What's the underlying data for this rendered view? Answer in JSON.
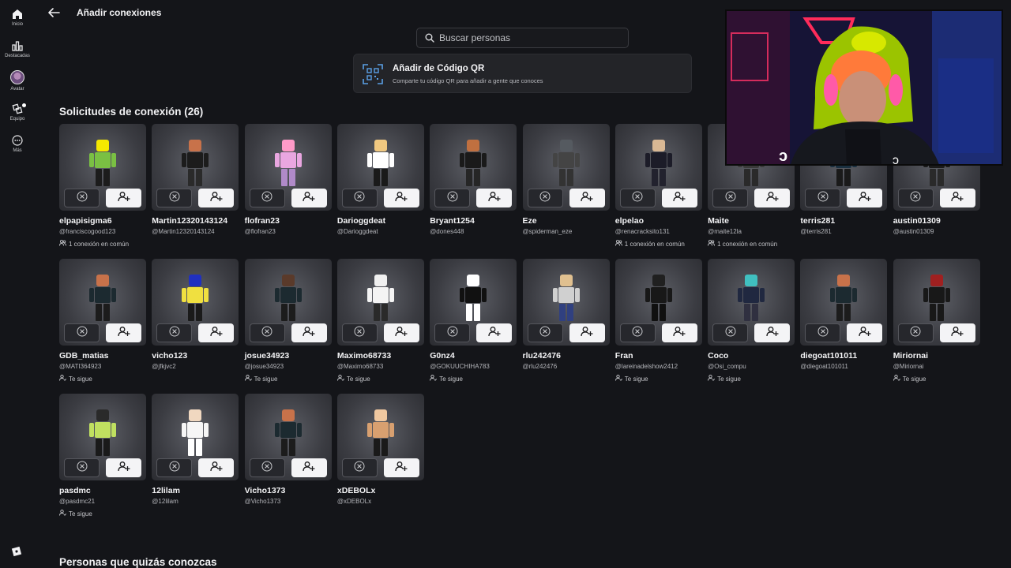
{
  "nav": {
    "items": [
      {
        "label": "Inicio",
        "icon": "home-icon"
      },
      {
        "label": "Destacadas",
        "icon": "charts-icon"
      },
      {
        "label": "Avatar",
        "icon": "avatar-icon"
      },
      {
        "label": "Equipo",
        "icon": "party-icon"
      },
      {
        "label": "Más",
        "icon": "more-icon"
      }
    ]
  },
  "header": {
    "title": "Añadir conexiones",
    "back_icon": "arrow-left-icon"
  },
  "search": {
    "placeholder": "Buscar personas"
  },
  "qr": {
    "title": "Añadir de Código QR",
    "subtitle": "Comparte tu código QR para añadir a gente que conoces"
  },
  "requests": {
    "title": "Solicitudes de conexión (26)",
    "cards": [
      {
        "name": "elpapisigma6",
        "username": "@franciscogood123",
        "meta": "1 conexión en común",
        "meta_icon": "people-icon"
      },
      {
        "name": "Martin12320143124",
        "username": "@Martin12320143124",
        "meta": "",
        "meta_icon": ""
      },
      {
        "name": "flofran23",
        "username": "@flofran23",
        "meta": "",
        "meta_icon": ""
      },
      {
        "name": "Darioggdeat",
        "username": "@Darioggdeat",
        "meta": "",
        "meta_icon": ""
      },
      {
        "name": "Bryant1254",
        "username": "@dones448",
        "meta": "",
        "meta_icon": ""
      },
      {
        "name": "Eze",
        "username": "@spiderman_eze",
        "meta": "",
        "meta_icon": ""
      },
      {
        "name": "elpelao",
        "username": "@renacracksito131",
        "meta": "1 conexión en común",
        "meta_icon": "people-icon"
      },
      {
        "name": "Maite",
        "username": "@maite12la",
        "meta": "1 conexión en común",
        "meta_icon": "people-icon"
      },
      {
        "name": "terris281",
        "username": "@terris281",
        "meta": "",
        "meta_icon": ""
      },
      {
        "name": "austin01309",
        "username": "@austin01309",
        "meta": "",
        "meta_icon": ""
      },
      {
        "name": "GDB_matias",
        "username": "@MATI364923",
        "meta": "Te sigue",
        "meta_icon": "follower-icon"
      },
      {
        "name": "vicho123",
        "username": "@jfkjvc2",
        "meta": "",
        "meta_icon": ""
      },
      {
        "name": "josue34923",
        "username": "@josue34923",
        "meta": "Te sigue",
        "meta_icon": "follower-icon"
      },
      {
        "name": "Maximo68733",
        "username": "@Maximo68733",
        "meta": "Te sigue",
        "meta_icon": "follower-icon"
      },
      {
        "name": "G0nz4",
        "username": "@GOKUUCHIHA783",
        "meta": "Te sigue",
        "meta_icon": "follower-icon"
      },
      {
        "name": "rlu242476",
        "username": "@rlu242476",
        "meta": "",
        "meta_icon": ""
      },
      {
        "name": "Fran",
        "username": "@lareinadelshow2412",
        "meta": "Te sigue",
        "meta_icon": "follower-icon"
      },
      {
        "name": "Coco",
        "username": "@Osi_compu",
        "meta": "Te sigue",
        "meta_icon": "follower-icon"
      },
      {
        "name": "diegoat101011",
        "username": "@diegoat101011",
        "meta": "",
        "meta_icon": ""
      },
      {
        "name": "Miriornai",
        "username": "@Miriornai",
        "meta": "Te sigue",
        "meta_icon": "follower-icon"
      },
      {
        "name": "pasdmc",
        "username": "@pasdmc21",
        "meta": "Te sigue",
        "meta_icon": "follower-icon"
      },
      {
        "name": "12lilam",
        "username": "@12lilam",
        "meta": "",
        "meta_icon": ""
      },
      {
        "name": "Vicho1373",
        "username": "@Vicho1373",
        "meta": "",
        "meta_icon": ""
      },
      {
        "name": "xDEBOLx",
        "username": "@xDEBOLx",
        "meta": "",
        "meta_icon": ""
      }
    ]
  },
  "suggestions": {
    "title": "Personas que quizás conozcas"
  },
  "colors": {
    "background": "#141519",
    "card": "#232428",
    "accept": "#f4f4f6"
  }
}
